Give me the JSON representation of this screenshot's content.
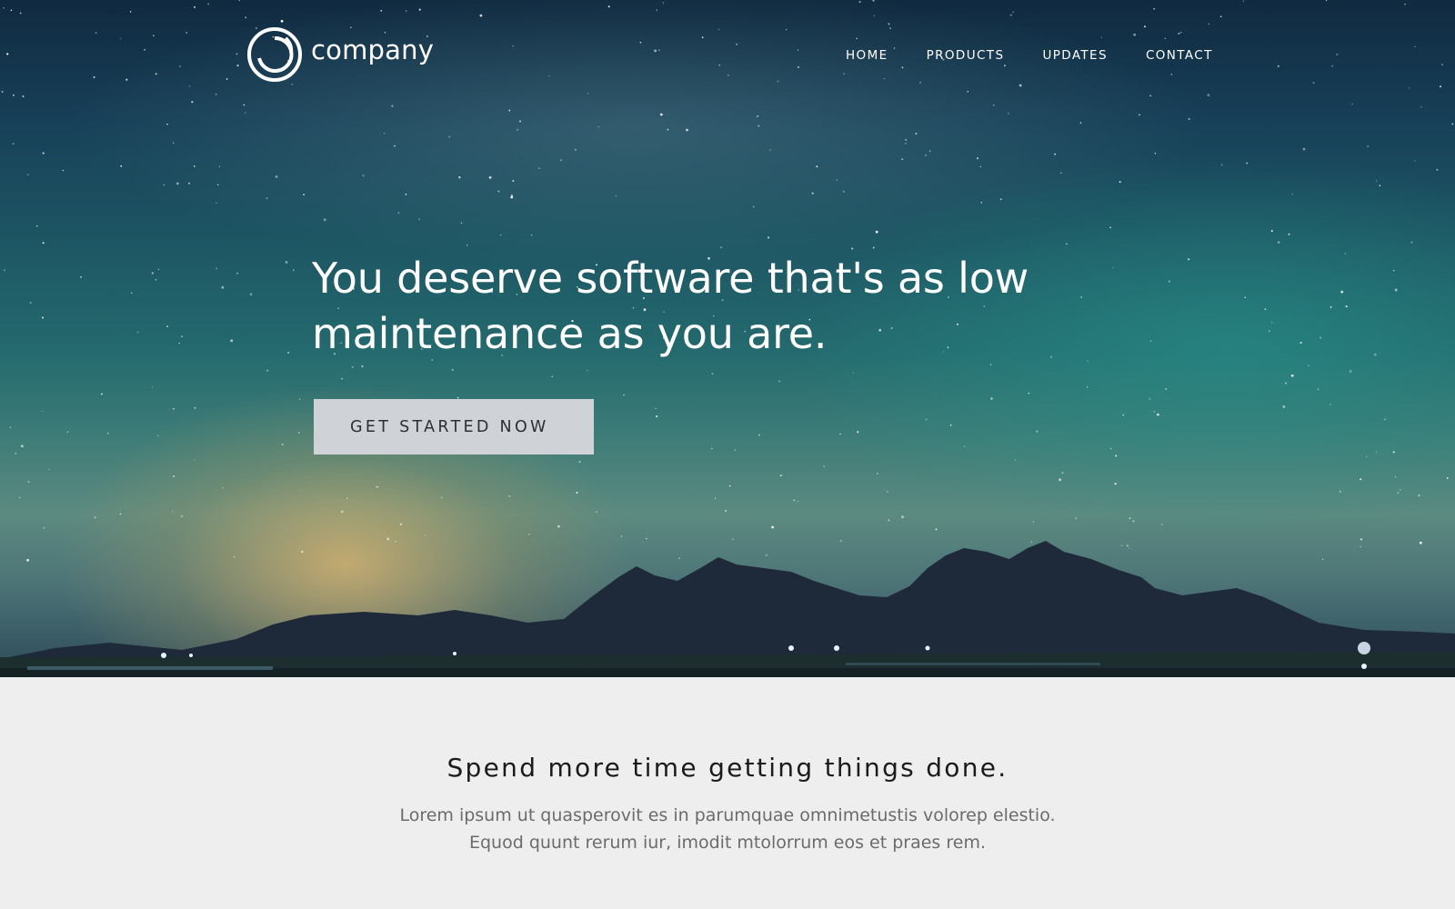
{
  "header": {
    "logo_text": "company",
    "logo_icon": "ring-logo-icon",
    "nav": [
      {
        "label": "HOME"
      },
      {
        "label": "PRODUCTS"
      },
      {
        "label": "UPDATES"
      },
      {
        "label": "CONTACT"
      }
    ]
  },
  "hero": {
    "title": "You deserve software that's as low maintenance as you are.",
    "cta_label": "GET STARTED NOW",
    "background": "starry-night-sky-over-mountains-image"
  },
  "features": {
    "title": "Spend more time getting things done.",
    "body_lines": [
      "Lorem ipsum ut quasperovit es in parumquae omnimetustis volorep elestio.",
      "Equod quunt rerum iur, imodit mtolorrum eos et praes rem."
    ]
  },
  "colors": {
    "cta_background": "#cfd3d7",
    "section_background": "#eeeeee",
    "text_dark": "#1b1b1b",
    "text_muted": "#6b6b6b"
  }
}
